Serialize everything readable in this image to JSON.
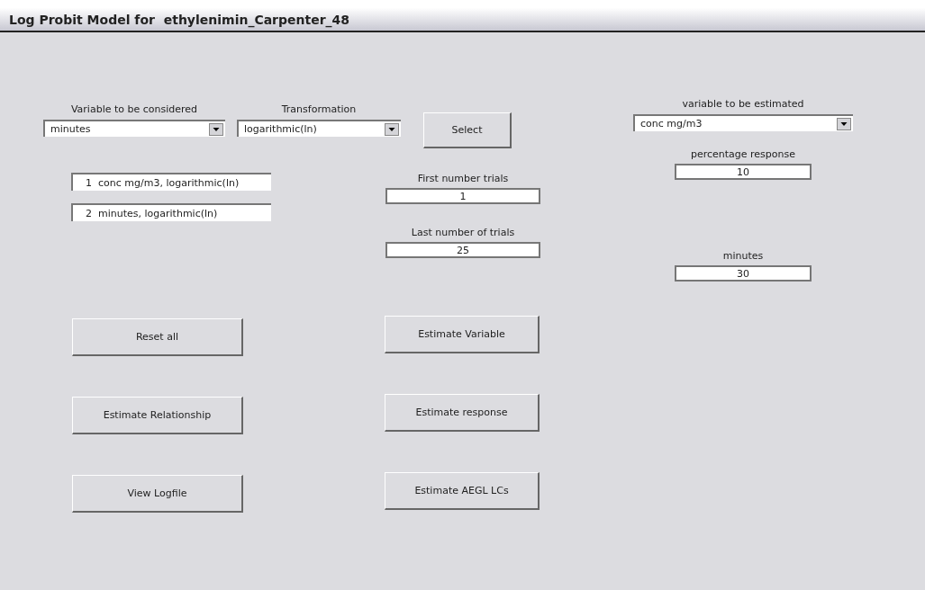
{
  "window": {
    "title": "Log Probit Model for  ethylenimin_Carpenter_48"
  },
  "selectors": [
    {
      "label": "Variable to be considered",
      "value": "minutes"
    },
    {
      "label": "Transformation",
      "value": "logarithmic(ln)"
    }
  ],
  "select_button": "Select",
  "selected_variables": [
    {
      "index": "1",
      "text": "conc mg/m3, logarithmic(ln)"
    },
    {
      "index": "2",
      "text": "minutes, logarithmic(ln)"
    }
  ],
  "trial_fields": [
    {
      "label": "First number trials",
      "value": "1"
    },
    {
      "label": "Last number of trials",
      "value": "25"
    }
  ],
  "left_buttons": [
    "Reset all",
    "Estimate Relationship",
    "View Logfile"
  ],
  "middle_buttons": [
    "Estimate Variable",
    "Estimate response",
    "Estimate AEGL LCs"
  ],
  "estimate_selector": {
    "label": "variable to be estimated",
    "value": "conc mg/m3"
  },
  "estimate_fields": [
    {
      "label": "percentage response",
      "value": "10"
    },
    {
      "label": "minutes",
      "value": "30"
    }
  ]
}
